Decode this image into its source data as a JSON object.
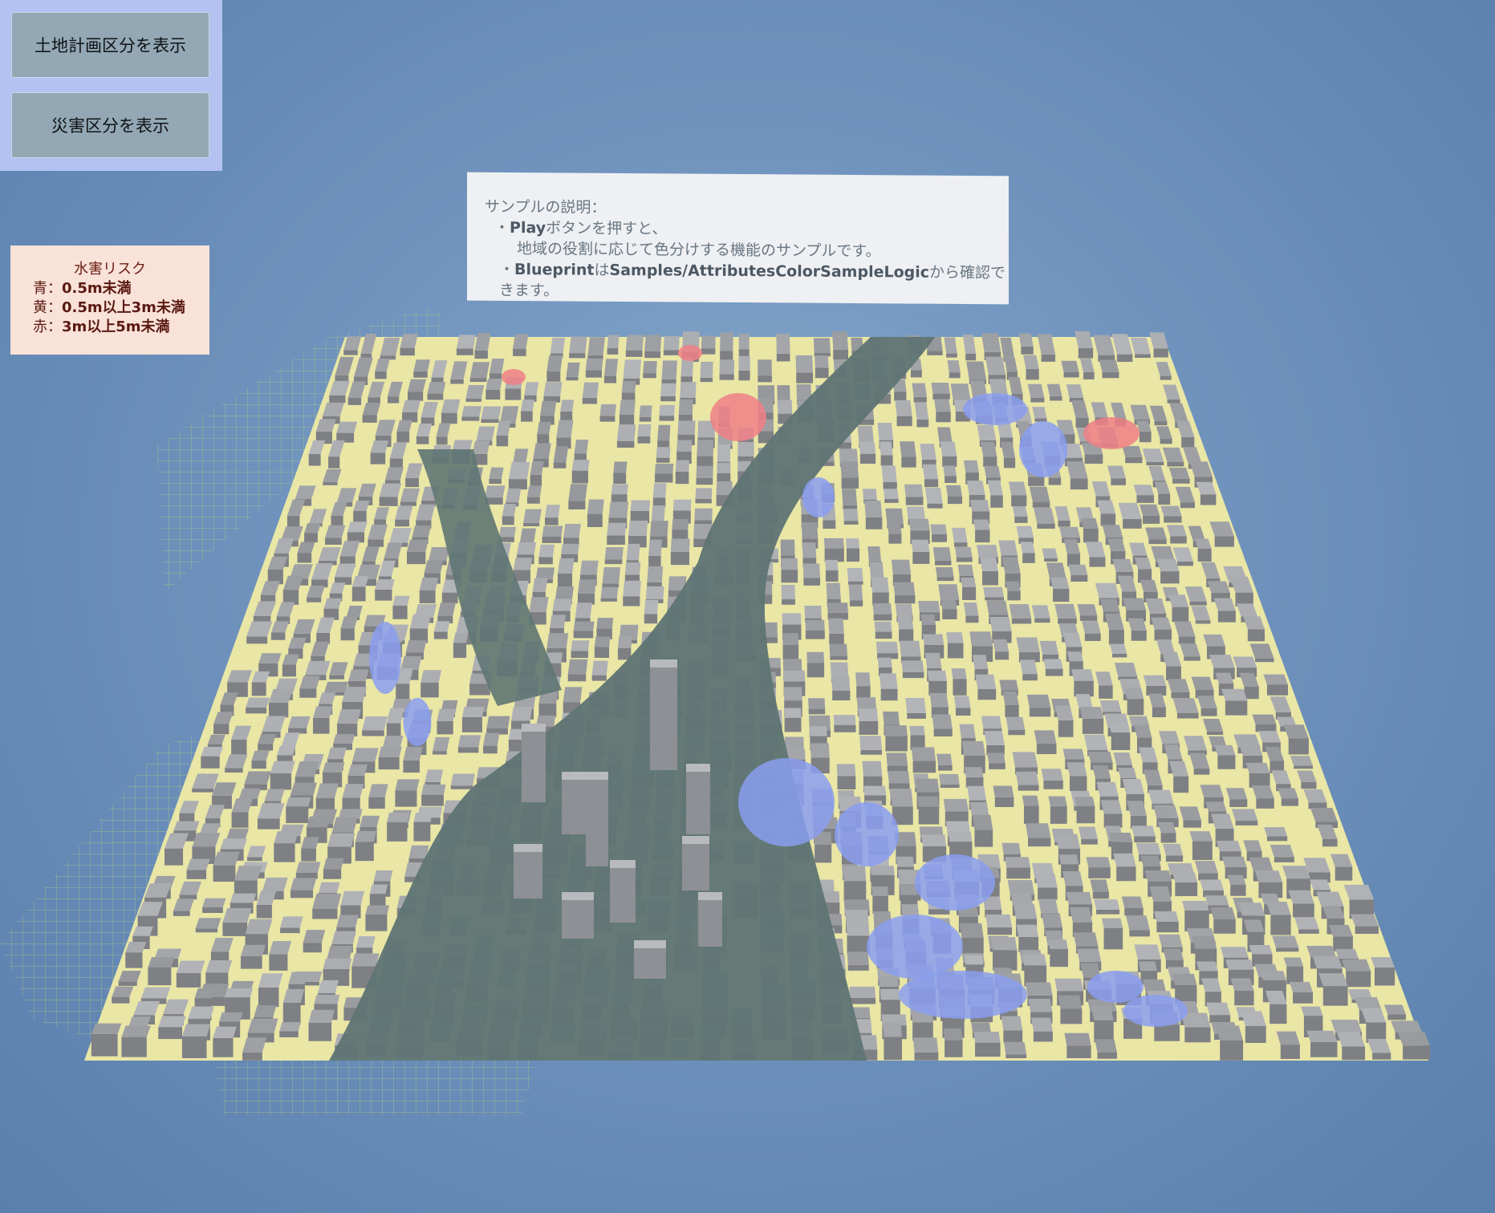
{
  "buttons": {
    "land_plan": "土地計画区分を表示",
    "disaster": "災害区分を表示"
  },
  "legend": {
    "title": "水害リスク",
    "blue_prefix": "青：",
    "blue_value": "0.5m未満",
    "yellow_prefix": "黄：",
    "yellow_value": "0.5m以上3m未満",
    "red_prefix": "赤：",
    "red_value": "3m以上5m未満"
  },
  "description": {
    "heading": "サンプルの説明：",
    "bullet": "・",
    "line1_bold": "Play",
    "line1_rest": "ボタンを押すと、",
    "line2": "地域の役割に応じて色分けする機能のサンプルです。",
    "line3_bold1": "Blueprint",
    "line3_mid": "は",
    "line3_bold2": "Samples/AttributesColorSampleLogic",
    "line3_rest": "から確認できます。"
  },
  "colors": {
    "risk_blue": "#8a9ef0",
    "risk_yellow": "#fdf5a0",
    "risk_red": "#f07f86",
    "river": "#5f7574",
    "building": "#9a9ca0",
    "panel_bg": "#b4c2f2",
    "button_bg": "#93a8b4",
    "legend_bg": "#f9e2d8"
  },
  "scene": {
    "blocks_seed": 7,
    "block_rows": 38,
    "block_cols": 44
  }
}
